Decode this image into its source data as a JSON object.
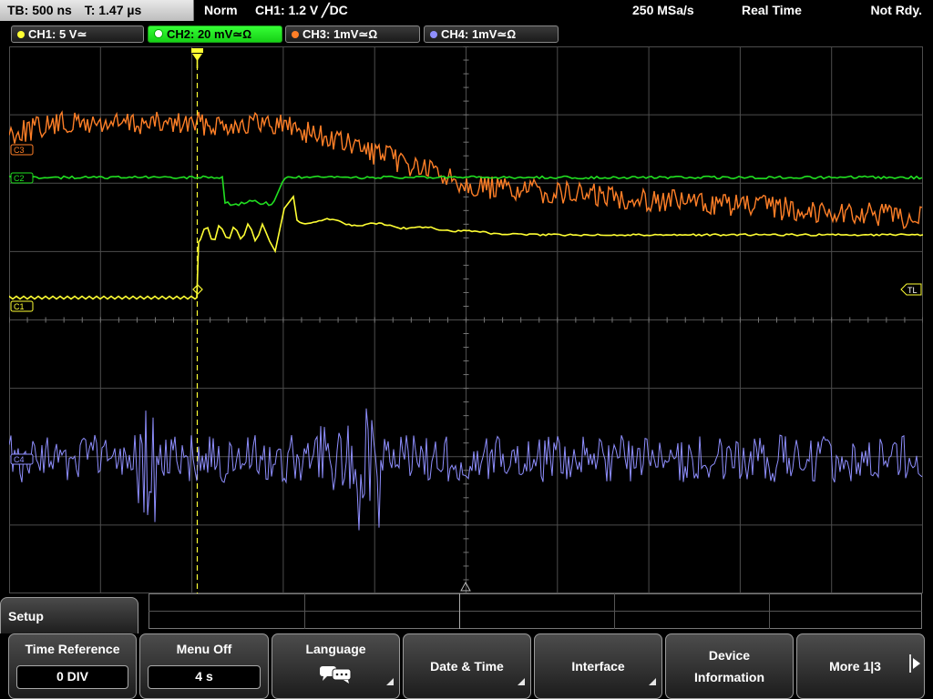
{
  "status": {
    "timebase": "TB: 500 ns",
    "trigger_time": "T: 1.47 µs",
    "mode": "Norm",
    "trigger_info": "CH1: 1.2 V ╱DC",
    "sample_rate": "250 MSa/s",
    "acquisition": "Real Time",
    "state": "Not Rdy."
  },
  "channels": [
    {
      "label": "CH1: 5 V≃",
      "color": "#ffff33",
      "active": false
    },
    {
      "label": "CH2: 20 mV≃Ω",
      "color": "#21e021",
      "active": true
    },
    {
      "label": "CH3: 1mV≃Ω",
      "color": "#ff7f27",
      "active": false
    },
    {
      "label": "CH4: 1mV≃Ω",
      "color": "#8f8fff",
      "active": false
    }
  ],
  "markers": {
    "ch3": "C3",
    "ch2": "C2",
    "ch1": "C1",
    "trigger_level": "TL",
    "ch4": "C4"
  },
  "colors": {
    "grid": "#4d4d4d",
    "ch1": "#ffff33",
    "ch2": "#21e021",
    "ch3": "#ff7f27",
    "ch4": "#8f8fff",
    "trigger_line": "#ffff33"
  },
  "menu": {
    "title": "Setup",
    "softkeys": [
      {
        "label": "Time Reference",
        "value": "0 DIV"
      },
      {
        "label": "Menu Off",
        "value": "4 s"
      },
      {
        "label": "Language",
        "icon": "speech-bubbles-icon"
      },
      {
        "label": "Date & Time"
      },
      {
        "label": "Interface"
      },
      {
        "label": "Device",
        "label2": "Information"
      },
      {
        "label": "More 1|3"
      }
    ]
  }
}
